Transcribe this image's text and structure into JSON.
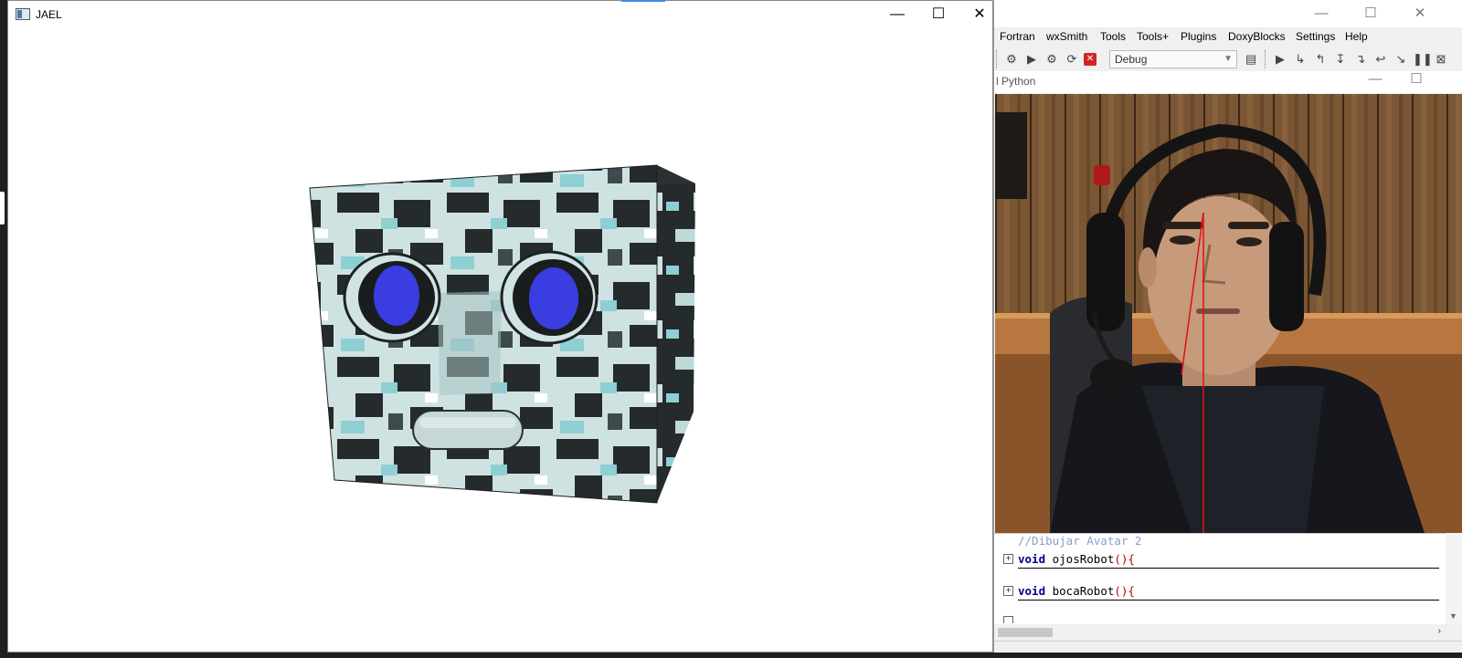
{
  "gl_window": {
    "title": "JAEL",
    "minimize": "—",
    "maximize": "☐",
    "close": "✕"
  },
  "ide": {
    "minimize": "—",
    "maximize": "☐",
    "close": "✕",
    "menus": [
      "Fortran",
      "wxSmith",
      "Tools",
      "Tools+",
      "Plugins",
      "DoxyBlocks",
      "Settings",
      "Help"
    ],
    "build_target": "Debug",
    "python_window_title": "l Python",
    "python_minimize": "—",
    "python_maximize": "☐",
    "code": {
      "comment": "//Dibujar Avatar 2",
      "line1_kw": "void",
      "line1_name": " ojosRobot",
      "line1_paren": "(){",
      "line2_kw": "void",
      "line2_name": " bocaRobot",
      "line2_paren": "(){"
    }
  },
  "colors": {
    "eye": "#3a3ee0",
    "cube_dark": "#252a2c",
    "cube_light": "#cfe2e2",
    "cube_cyan": "#8ecfd3",
    "wall": "#7a5634",
    "hoodie": "#15171c",
    "tracking_line": "#e01010"
  },
  "icons": [
    "gear-icon",
    "play-icon",
    "build-run-icon",
    "rebuild-icon",
    "stop-icon",
    "build-log-icon",
    "debug-run-icon",
    "step-icon",
    "pause-icon",
    "debug-stop-icon"
  ]
}
